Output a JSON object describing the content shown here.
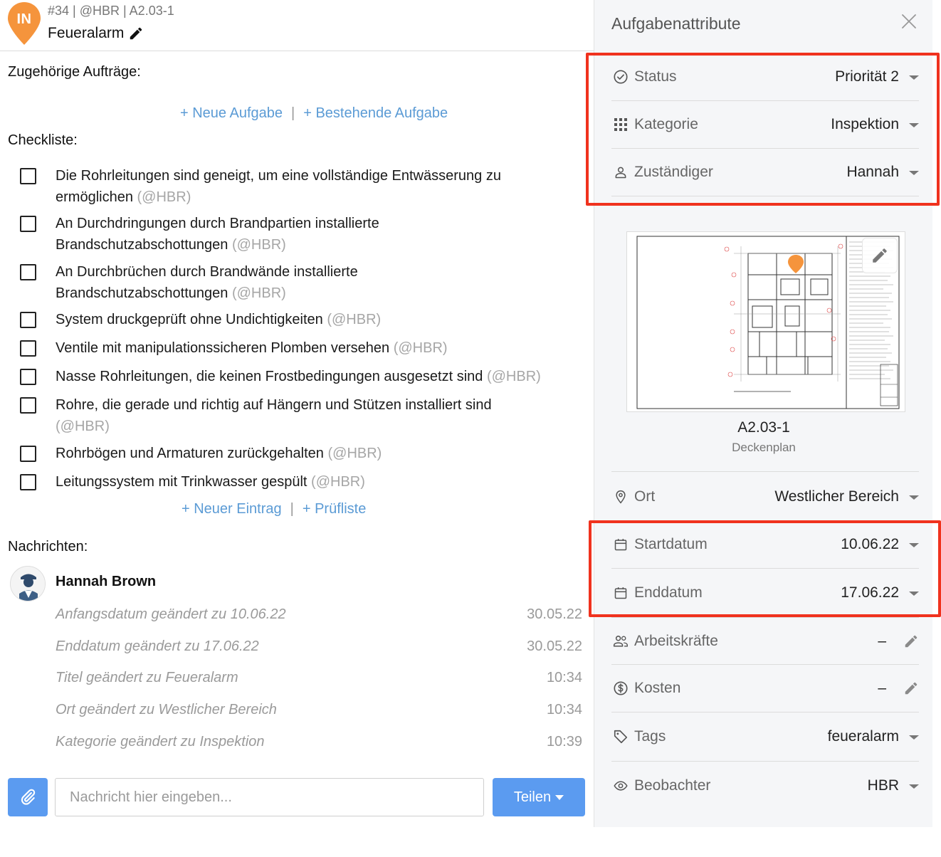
{
  "task": {
    "badge": "IN",
    "meta": "#34 | @HBR | A2.03-1",
    "title": "Feueralarm",
    "pin_color": "#f5943c"
  },
  "related": {
    "label": "Zugehörige Aufträge:",
    "new_task": "+ Neue Aufgabe",
    "existing_task": "+ Bestehende Aufgabe",
    "separator": "|"
  },
  "checklist": {
    "label": "Checkliste:",
    "items": [
      {
        "text": "Die Rohrleitungen sind geneigt, um eine vollständige Entwässerung zu ermöglichen",
        "user": "(@HBR)"
      },
      {
        "text": "An Durchdringungen durch Brandpartien installierte Brandschutzabschottungen",
        "user": "(@HBR)"
      },
      {
        "text": "An Durchbrüchen durch Brandwände installierte Brandschutzabschottungen",
        "user": "(@HBR)"
      },
      {
        "text": "System druckgeprüft ohne Undichtigkeiten",
        "user": "(@HBR)"
      },
      {
        "text": "Ventile mit manipulationssicheren Plomben versehen",
        "user": "(@HBR)"
      },
      {
        "text": "Nasse Rohrleitungen, die keinen Frostbedingungen ausgesetzt sind",
        "user": "(@HBR)"
      },
      {
        "text": "Rohre, die gerade und richtig auf Hängern und Stützen installiert sind",
        "user": "(@HBR)"
      },
      {
        "text": "Rohrbögen und Armaturen zurückgehalten",
        "user": "(@HBR)"
      },
      {
        "text": "Leitungssystem mit Trinkwasser gespült",
        "user": "(@HBR)"
      }
    ],
    "new_entry": "+ Neuer Eintrag",
    "checklist_link": "+ Prüfliste",
    "separator": "|"
  },
  "messages": {
    "label": "Nachrichten:",
    "author": "Hannah Brown",
    "entries": [
      {
        "text": "Anfangsdatum geändert zu 10.06.22",
        "time": "30.05.22"
      },
      {
        "text": "Enddatum geändert zu 17.06.22",
        "time": "30.05.22"
      },
      {
        "text": "Titel geändert zu Feueralarm",
        "time": "10:34"
      },
      {
        "text": "Ort geändert zu Westlicher Bereich",
        "time": "10:34"
      },
      {
        "text": "Kategorie geändert zu Inspektion",
        "time": "10:39"
      }
    ],
    "input_placeholder": "Nachricht hier eingeben...",
    "share_label": "Teilen"
  },
  "attributes": {
    "title": "Aufgabenattribute",
    "status": {
      "label": "Status",
      "value": "Priorität 2",
      "icon": "check-circle-icon"
    },
    "category": {
      "label": "Kategorie",
      "value": "Inspektion",
      "icon": "grid-icon"
    },
    "assignee": {
      "label": "Zuständiger",
      "value": "Hannah",
      "icon": "person-icon"
    },
    "plan": {
      "name": "A2.03-1",
      "subtitle": "Deckenplan"
    },
    "location": {
      "label": "Ort",
      "value": "Westlicher Bereich",
      "icon": "location-pin-icon"
    },
    "start": {
      "label": "Startdatum",
      "value": "10.06.22",
      "icon": "calendar-icon"
    },
    "end": {
      "label": "Enddatum",
      "value": "17.06.22",
      "icon": "calendar-icon"
    },
    "workforce": {
      "label": "Arbeitskräfte",
      "value": "–",
      "icon": "people-icon"
    },
    "costs": {
      "label": "Kosten",
      "value": "–",
      "icon": "dollar-circle-icon"
    },
    "tags": {
      "label": "Tags",
      "value": "feueralarm",
      "icon": "tag-icon"
    },
    "watchers": {
      "label": "Beobachter",
      "value": "HBR",
      "icon": "eye-icon"
    }
  },
  "colors": {
    "accent_blue": "#5b9bf0",
    "link_blue": "#5b9bd5",
    "highlight_red": "#f0321e"
  }
}
